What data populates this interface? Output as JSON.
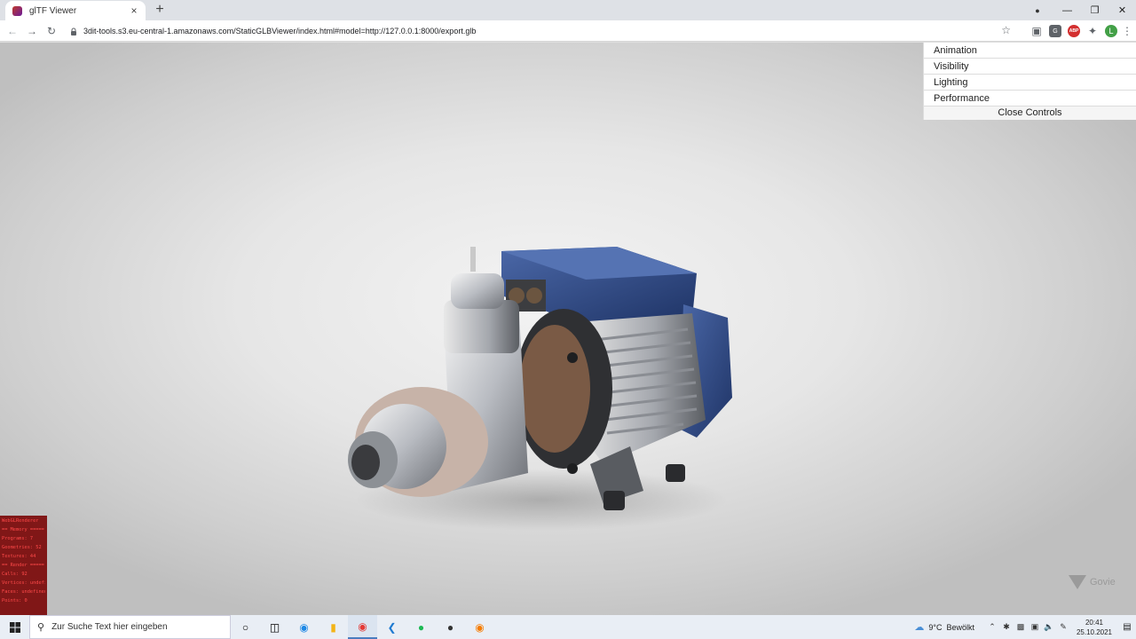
{
  "browser": {
    "tab_title": "glTF Viewer",
    "tab_close": "×",
    "new_tab": "+",
    "url": "3dit-tools.s3.eu-central-1.amazonaws.com/StaticGLBViewer/index.html#model=http://127.0.0.1:8000/export.glb",
    "profile_initial": "L",
    "ext_abp": "ABP"
  },
  "controls": {
    "folders": [
      "Animation",
      "Visibility",
      "Lighting",
      "Performance"
    ],
    "close_label": "Close Controls"
  },
  "stats": [
    "WebGLRenderer",
    "== Memory =====",
    "Programs: 7",
    "Geometries: 52",
    "Textures: 44",
    "== Render =====",
    "Calls: 92",
    "Vertices: undefined",
    "Faces: undefined",
    "Points: 0"
  ],
  "watermark": "Govie",
  "taskbar": {
    "search_placeholder": "Zur Suche Text hier eingeben",
    "weather_temp": "9°C",
    "weather_text": "Bewölkt",
    "time": "20:41",
    "date": "25.10.2021"
  },
  "colors": {
    "motor_blue": "#2c4a8c",
    "stats_bg": "#780000",
    "stats_text": "#ff4a4a"
  }
}
